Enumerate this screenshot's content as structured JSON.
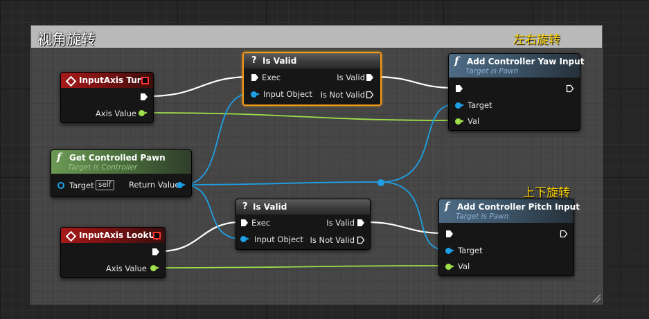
{
  "comment": {
    "title": "视角旋转"
  },
  "notes": {
    "yaw": "左右旋转",
    "pitch": "上下旋转"
  },
  "colors": {
    "exec_wire": "#ffffff",
    "object_wire": "#1ea0e6",
    "float_wire": "#9fe04a",
    "selected_border": "#f09a1a",
    "note": "#ffd400"
  },
  "nodes": {
    "axis_turn": {
      "title": "InputAxis Turn",
      "axis_value": "Axis Value"
    },
    "axis_lookup": {
      "title": "InputAxis LookUp",
      "axis_value": "Axis Value"
    },
    "get_pawn": {
      "title": "Get Controlled Pawn",
      "subtitle": "Target is Controller",
      "target": "Target",
      "self": "self",
      "return_value": "Return Value"
    },
    "is_valid_1": {
      "title": "Is Valid",
      "exec": "Exec",
      "input_object": "Input Object",
      "is_valid": "Is Valid",
      "is_not_valid": "Is Not Valid"
    },
    "is_valid_2": {
      "title": "Is Valid",
      "exec": "Exec",
      "input_object": "Input Object",
      "is_valid": "Is Valid",
      "is_not_valid": "Is Not Valid"
    },
    "yaw_input": {
      "title": "Add Controller Yaw Input",
      "subtitle": "Target is Pawn",
      "target": "Target",
      "val": "Val"
    },
    "pitch_input": {
      "title": "Add Controller Pitch Input",
      "subtitle": "Target is Pawn",
      "target": "Target",
      "val": "Val"
    }
  },
  "icons": {
    "event": "diamond-event-icon",
    "function": "function-f-icon",
    "macro": "question-mark-icon",
    "delegate": "red-square-delegate-icon"
  }
}
